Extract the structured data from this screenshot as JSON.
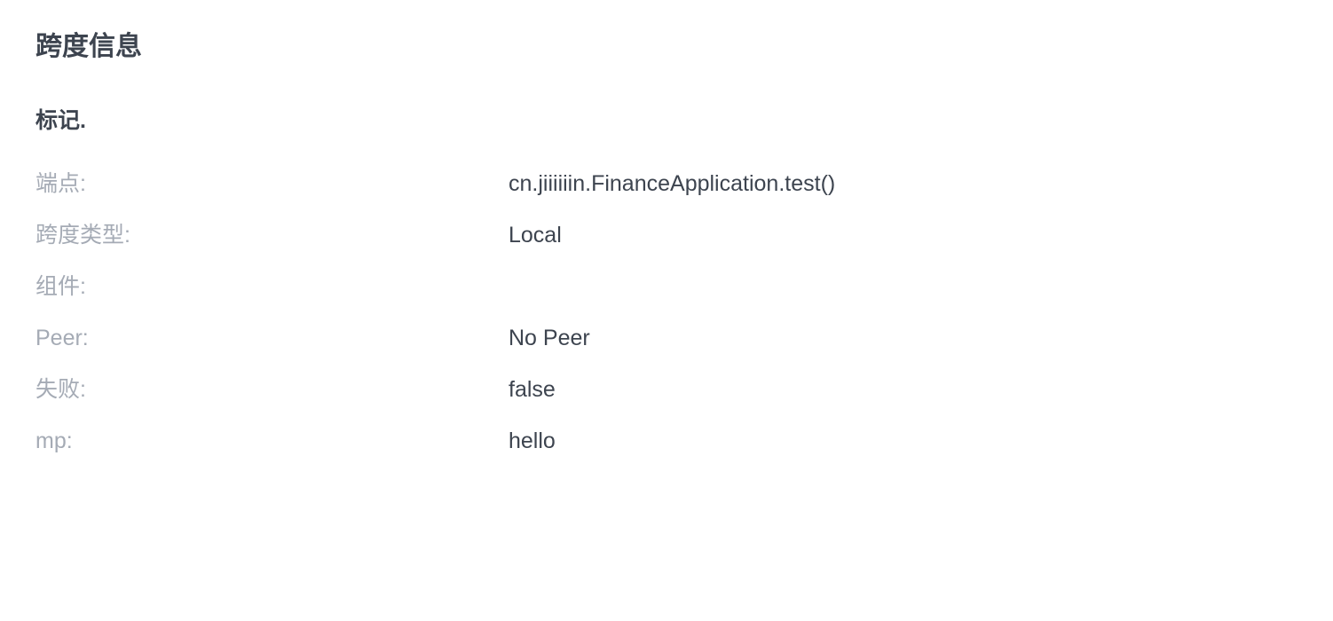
{
  "panel": {
    "title": "跨度信息",
    "section_title": "标记.",
    "rows": [
      {
        "label": "端点:",
        "value": "cn.jiiiiiin.FinanceApplication.test()"
      },
      {
        "label": "跨度类型:",
        "value": "Local"
      },
      {
        "label": "组件:",
        "value": ""
      },
      {
        "label": "Peer:",
        "value": "No Peer"
      },
      {
        "label": "失败:",
        "value": "false"
      },
      {
        "label": "mp:",
        "value": "hello"
      }
    ]
  },
  "colors": {
    "text_primary": "#3d444f",
    "text_label": "#a5abb5",
    "background": "#ffffff"
  }
}
